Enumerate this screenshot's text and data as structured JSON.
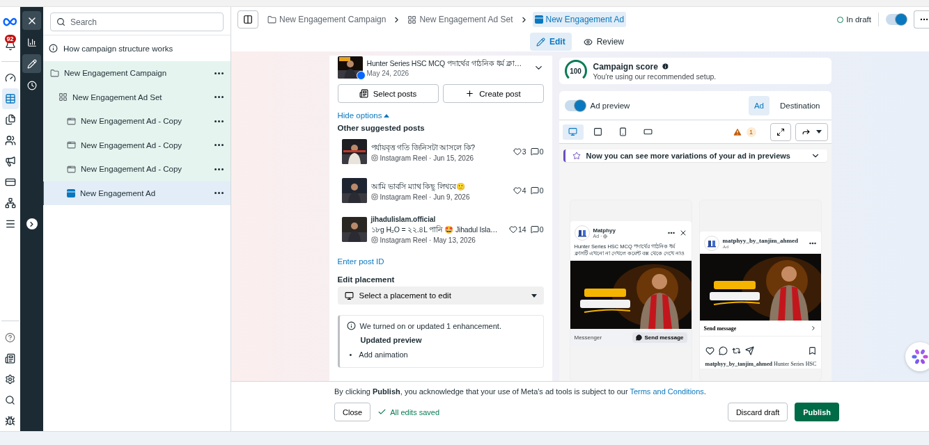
{
  "rail": {
    "badge": "92",
    "items": [
      {
        "selected": false
      },
      {
        "selected": true
      },
      {
        "selected": false
      },
      {
        "selected": false
      },
      {
        "selected": false
      },
      {
        "selected": false
      },
      {
        "selected": false
      },
      {
        "selected": false
      }
    ]
  },
  "tool_rail": {
    "items": [
      {
        "selected": false
      },
      {
        "selected": true
      },
      {
        "selected": false
      }
    ]
  },
  "tree": {
    "search": {
      "placeholder": "Search"
    },
    "help": "How campaign structure works",
    "items": [
      {
        "kind": "campaign",
        "label": "New Engagement Campaign",
        "selected": false,
        "children": [
          {
            "kind": "ad_set",
            "label": "New Engagement Ad Set",
            "selected": false,
            "children": [
              {
                "kind": "ad",
                "label": "New Engagement Ad - Copy",
                "selected": false
              },
              {
                "kind": "ad",
                "label": "New Engagement Ad - Copy",
                "selected": false
              },
              {
                "kind": "ad",
                "label": "New Engagement Ad - Copy",
                "selected": false
              },
              {
                "kind": "ad",
                "label": "New Engagement Ad",
                "selected": true
              }
            ]
          }
        ]
      }
    ]
  },
  "breadcrumb": [
    {
      "kind": "campaign",
      "label": "New Engagement Campaign",
      "selected": false
    },
    {
      "kind": "ad_set",
      "label": "New Engagement Ad Set",
      "selected": false
    },
    {
      "kind": "ad",
      "label": "New Engagement Ad",
      "selected": true
    }
  ],
  "status": {
    "label": "In draft",
    "on": true
  },
  "modes": [
    {
      "kind": "edit",
      "label": "Edit",
      "selected": true
    },
    {
      "kind": "review",
      "label": "Review",
      "selected": false
    }
  ],
  "post": {
    "title": "Hunter Series HSC MCQ পদার্থের গাঠনিক ধর্ম ক্লা…",
    "date": "May 24, 2026"
  },
  "post_buttons": [
    {
      "kind": "select",
      "label": "Select posts"
    },
    {
      "kind": "create",
      "label": "Create post"
    }
  ],
  "hide_options": "Hide options",
  "suggested_title": "Other suggested posts",
  "suggested_posts": [
    {
      "title": "পর্যায়বৃত্ত গতি জিনিসটা আসলে কি?",
      "meta": "Instagram Reel · Jun 15, 2026",
      "likes": "3",
      "comments": "0"
    },
    {
      "title": "আমি ভাবসি ম্যাথ কিছু লিখবে🙂",
      "meta": "Instagram Reel · Jun 9, 2026",
      "likes": "4",
      "comments": "0"
    },
    {
      "author": "jihadulislam.official",
      "title": "১৮g H₂O = ২২.৪L পানি 🤩 Jihadul Isla…",
      "meta": "Instagram Reel · May 13, 2026",
      "likes": "14",
      "comments": "0"
    }
  ],
  "enter_post_id": "Enter post ID",
  "placement": {
    "label": "Edit placement",
    "placeholder": "Select a placement to edit"
  },
  "notice": {
    "text": "We turned on or updated 1 enhancement.",
    "heading": "Updated preview",
    "bullets": [
      "Add animation"
    ],
    "marker": "•"
  },
  "score": {
    "value": "100",
    "title": "Campaign score",
    "subtitle": "You're using our recommended setup."
  },
  "preview": {
    "toggle": {
      "label": "Ad preview",
      "on": true
    },
    "tabs": [
      {
        "label": "Ad",
        "selected": true
      },
      {
        "label": "Destination",
        "selected": false
      }
    ],
    "formats": [
      {
        "selected": true
      },
      {
        "selected": false
      },
      {
        "selected": false
      },
      {
        "selected": false
      }
    ],
    "warnings": "1",
    "banner": "Now you can see more variations of your ad in previews"
  },
  "fb_ad": {
    "page": "Matphyy",
    "sub": "Ad ·",
    "caption": "Hunter Series HSC MCQ পদার্থের গাঠনিক ধর্ম ক্লাসটি এখনো না দেখলে কমেন্ট বক্স থেকে দেখে নাও",
    "app": "Messenger",
    "cta": "Send message"
  },
  "ig_ad": {
    "account": "matphyy_by_tanjim_ahmed",
    "sub": "Ad",
    "cta": "Send message",
    "caption_user": "matphyy_by_tanjim_ahmed",
    "caption": "Hunter Series HSC"
  },
  "footer": {
    "notice": "By clicking **Publish**, you acknowledge that your use of Meta's ad tools is subject to our",
    "link": "Terms and Conditions",
    "notice_end": ".",
    "close": "Close",
    "saved": "All edits saved",
    "discard": "Discard draft",
    "publish": "Publish"
  }
}
